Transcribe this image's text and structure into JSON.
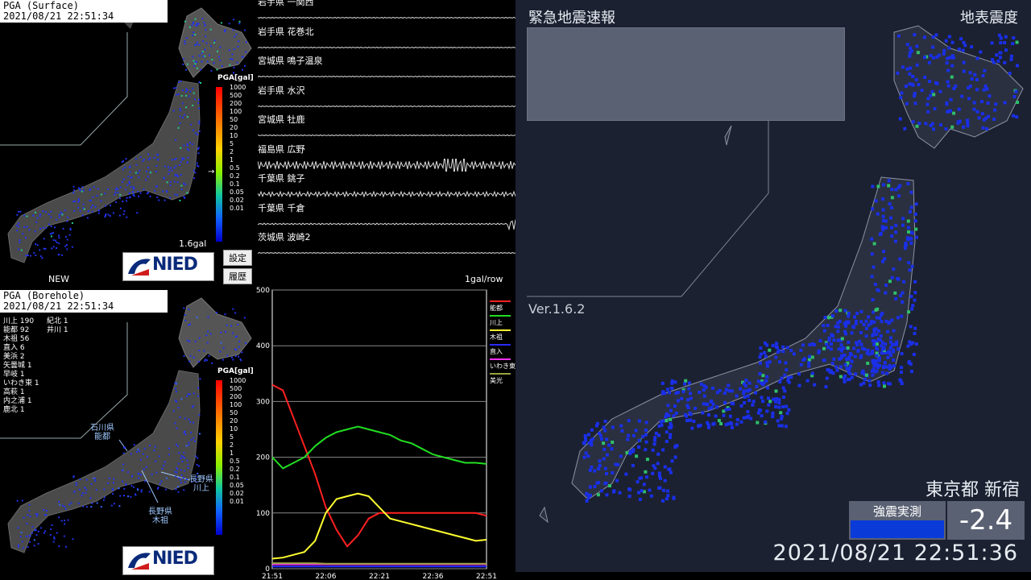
{
  "surface": {
    "stamp_title": "PGA (Surface)",
    "stamp_time": "2021/08/21  22:51:34",
    "scale_title": "PGA[gal]",
    "scale_ticks": [
      "1000",
      "500",
      "200",
      "100",
      "50",
      "20",
      "10",
      "5",
      "2",
      "1",
      "0.5",
      "0.2",
      "0.1",
      "0.05",
      "0.02",
      "0.01"
    ],
    "max_label": "1.6gal",
    "new_label": "NEW",
    "pointer_arrow": "→"
  },
  "buttons": {
    "settings": "設定",
    "history": "履歴"
  },
  "nied": {
    "text": "NIED"
  },
  "borehole": {
    "stamp_title": "PGA (Borehole)",
    "stamp_time": "2021/08/21  22:51:34",
    "scale_title": "PGA[gal]",
    "scale_ticks": [
      "1000",
      "500",
      "200",
      "100",
      "50",
      "20",
      "10",
      "5",
      "2",
      "1",
      "0.5",
      "0.2",
      "0.1",
      "0.05",
      "0.02",
      "0.01"
    ],
    "stats_left": [
      "川上 190",
      "能都 92",
      "木祖 56",
      "直入 6",
      "美浜 2",
      "矢曇城 1",
      "早岐 1",
      "いわき東 1",
      "高萩 1",
      "内之浦 1",
      "鹿北 1"
    ],
    "stats_right": [
      "紀北 1",
      "井川 1"
    ],
    "callouts": {
      "noto": [
        "石川県",
        "能都"
      ],
      "kawakami": [
        "長野県",
        "川上"
      ],
      "kiso": [
        "長野県",
        "木祖"
      ]
    }
  },
  "waveforms": [
    {
      "label": "岩手県 一関西"
    },
    {
      "label": "岩手県 花巻北"
    },
    {
      "label": "宮城県 鳴子温泉"
    },
    {
      "label": "岩手県 水沢"
    },
    {
      "label": "宮城県 牡鹿"
    },
    {
      "label": "福島県 広野"
    },
    {
      "label": "千葉県 銚子"
    },
    {
      "label": "千葉県 千倉"
    },
    {
      "label": "茨城県 波崎2"
    }
  ],
  "graph_unit": "1gal/row",
  "chart_data": {
    "type": "line",
    "x": [
      "21:51",
      "21:54",
      "21:57",
      "22:00",
      "22:03",
      "22:06",
      "22:09",
      "22:12",
      "22:15",
      "22:18",
      "22:21",
      "22:24",
      "22:27",
      "22:30",
      "22:33",
      "22:36",
      "22:39",
      "22:42",
      "22:45",
      "22:48",
      "22:51"
    ],
    "ylim": [
      0,
      500
    ],
    "yticks": [
      "500",
      "400",
      "300",
      "200",
      "100",
      "0"
    ],
    "xticks": [
      "21:51",
      "22:06",
      "22:21",
      "22:36",
      "22:51"
    ],
    "series": [
      {
        "name": "能都",
        "color": "#ff2020",
        "values": [
          330,
          320,
          270,
          220,
          170,
          110,
          70,
          40,
          60,
          90,
          100,
          100,
          100,
          100,
          100,
          100,
          100,
          100,
          100,
          100,
          95
        ]
      },
      {
        "name": "川上",
        "color": "#22dd22",
        "values": [
          200,
          180,
          190,
          200,
          220,
          235,
          245,
          250,
          255,
          250,
          245,
          240,
          230,
          225,
          215,
          205,
          200,
          195,
          190,
          190,
          188
        ]
      },
      {
        "name": "木祖",
        "color": "#ffff30",
        "values": [
          18,
          20,
          25,
          30,
          50,
          100,
          125,
          130,
          135,
          130,
          110,
          90,
          85,
          80,
          75,
          70,
          65,
          60,
          55,
          50,
          52
        ]
      },
      {
        "name": "直入",
        "color": "#2a2aff",
        "values": [
          4,
          4,
          4,
          4,
          4,
          4,
          4,
          4,
          4,
          4,
          4,
          4,
          4,
          4,
          4,
          4,
          4,
          4,
          4,
          4,
          4
        ]
      },
      {
        "name": "いわき東",
        "color": "#ff30ff",
        "values": [
          8,
          8,
          8,
          8,
          8,
          8,
          8,
          8,
          8,
          8,
          8,
          8,
          8,
          8,
          8,
          8,
          8,
          8,
          8,
          8,
          8
        ]
      },
      {
        "name": "美光",
        "color": "#9aa040",
        "values": [
          10,
          10,
          10,
          10,
          10,
          9,
          9,
          9,
          9,
          9,
          9,
          9,
          9,
          9,
          9,
          9,
          9,
          9,
          9,
          9,
          9
        ]
      }
    ]
  },
  "eew": {
    "title": "緊急地震速報",
    "kind": "地表震度",
    "version": "Ver.1.6.2",
    "station": "東京都 新宿",
    "measured_label": "強震実測",
    "measured_value": "-2.4",
    "datetime": "2021/08/21   22:51:36"
  }
}
